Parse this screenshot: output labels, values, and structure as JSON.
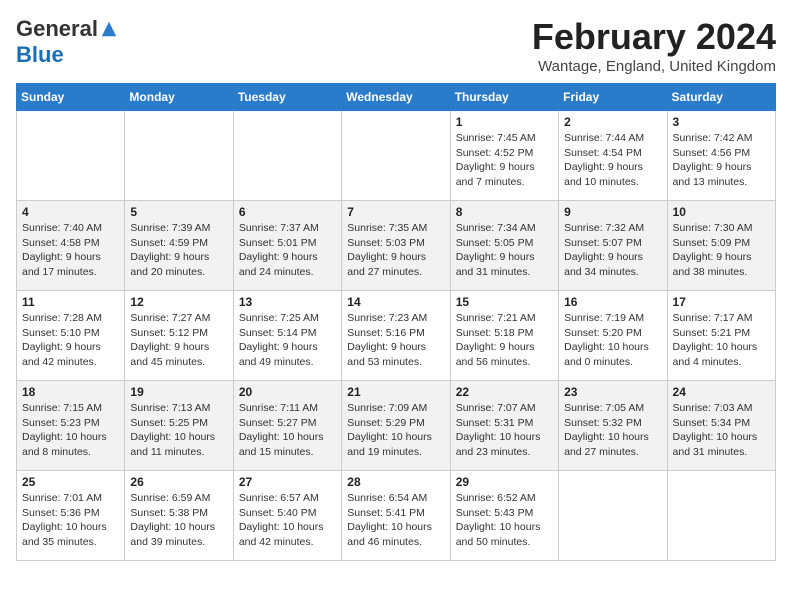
{
  "header": {
    "logo_line1": "General",
    "logo_line2": "Blue",
    "month": "February 2024",
    "location": "Wantage, England, United Kingdom"
  },
  "weekdays": [
    "Sunday",
    "Monday",
    "Tuesday",
    "Wednesday",
    "Thursday",
    "Friday",
    "Saturday"
  ],
  "weeks": [
    [
      {
        "day": "",
        "info": ""
      },
      {
        "day": "",
        "info": ""
      },
      {
        "day": "",
        "info": ""
      },
      {
        "day": "",
        "info": ""
      },
      {
        "day": "1",
        "info": "Sunrise: 7:45 AM\nSunset: 4:52 PM\nDaylight: 9 hours and 7 minutes."
      },
      {
        "day": "2",
        "info": "Sunrise: 7:44 AM\nSunset: 4:54 PM\nDaylight: 9 hours and 10 minutes."
      },
      {
        "day": "3",
        "info": "Sunrise: 7:42 AM\nSunset: 4:56 PM\nDaylight: 9 hours and 13 minutes."
      }
    ],
    [
      {
        "day": "4",
        "info": "Sunrise: 7:40 AM\nSunset: 4:58 PM\nDaylight: 9 hours and 17 minutes."
      },
      {
        "day": "5",
        "info": "Sunrise: 7:39 AM\nSunset: 4:59 PM\nDaylight: 9 hours and 20 minutes."
      },
      {
        "day": "6",
        "info": "Sunrise: 7:37 AM\nSunset: 5:01 PM\nDaylight: 9 hours and 24 minutes."
      },
      {
        "day": "7",
        "info": "Sunrise: 7:35 AM\nSunset: 5:03 PM\nDaylight: 9 hours and 27 minutes."
      },
      {
        "day": "8",
        "info": "Sunrise: 7:34 AM\nSunset: 5:05 PM\nDaylight: 9 hours and 31 minutes."
      },
      {
        "day": "9",
        "info": "Sunrise: 7:32 AM\nSunset: 5:07 PM\nDaylight: 9 hours and 34 minutes."
      },
      {
        "day": "10",
        "info": "Sunrise: 7:30 AM\nSunset: 5:09 PM\nDaylight: 9 hours and 38 minutes."
      }
    ],
    [
      {
        "day": "11",
        "info": "Sunrise: 7:28 AM\nSunset: 5:10 PM\nDaylight: 9 hours and 42 minutes."
      },
      {
        "day": "12",
        "info": "Sunrise: 7:27 AM\nSunset: 5:12 PM\nDaylight: 9 hours and 45 minutes."
      },
      {
        "day": "13",
        "info": "Sunrise: 7:25 AM\nSunset: 5:14 PM\nDaylight: 9 hours and 49 minutes."
      },
      {
        "day": "14",
        "info": "Sunrise: 7:23 AM\nSunset: 5:16 PM\nDaylight: 9 hours and 53 minutes."
      },
      {
        "day": "15",
        "info": "Sunrise: 7:21 AM\nSunset: 5:18 PM\nDaylight: 9 hours and 56 minutes."
      },
      {
        "day": "16",
        "info": "Sunrise: 7:19 AM\nSunset: 5:20 PM\nDaylight: 10 hours and 0 minutes."
      },
      {
        "day": "17",
        "info": "Sunrise: 7:17 AM\nSunset: 5:21 PM\nDaylight: 10 hours and 4 minutes."
      }
    ],
    [
      {
        "day": "18",
        "info": "Sunrise: 7:15 AM\nSunset: 5:23 PM\nDaylight: 10 hours and 8 minutes."
      },
      {
        "day": "19",
        "info": "Sunrise: 7:13 AM\nSunset: 5:25 PM\nDaylight: 10 hours and 11 minutes."
      },
      {
        "day": "20",
        "info": "Sunrise: 7:11 AM\nSunset: 5:27 PM\nDaylight: 10 hours and 15 minutes."
      },
      {
        "day": "21",
        "info": "Sunrise: 7:09 AM\nSunset: 5:29 PM\nDaylight: 10 hours and 19 minutes."
      },
      {
        "day": "22",
        "info": "Sunrise: 7:07 AM\nSunset: 5:31 PM\nDaylight: 10 hours and 23 minutes."
      },
      {
        "day": "23",
        "info": "Sunrise: 7:05 AM\nSunset: 5:32 PM\nDaylight: 10 hours and 27 minutes."
      },
      {
        "day": "24",
        "info": "Sunrise: 7:03 AM\nSunset: 5:34 PM\nDaylight: 10 hours and 31 minutes."
      }
    ],
    [
      {
        "day": "25",
        "info": "Sunrise: 7:01 AM\nSunset: 5:36 PM\nDaylight: 10 hours and 35 minutes."
      },
      {
        "day": "26",
        "info": "Sunrise: 6:59 AM\nSunset: 5:38 PM\nDaylight: 10 hours and 39 minutes."
      },
      {
        "day": "27",
        "info": "Sunrise: 6:57 AM\nSunset: 5:40 PM\nDaylight: 10 hours and 42 minutes."
      },
      {
        "day": "28",
        "info": "Sunrise: 6:54 AM\nSunset: 5:41 PM\nDaylight: 10 hours and 46 minutes."
      },
      {
        "day": "29",
        "info": "Sunrise: 6:52 AM\nSunset: 5:43 PM\nDaylight: 10 hours and 50 minutes."
      },
      {
        "day": "",
        "info": ""
      },
      {
        "day": "",
        "info": ""
      }
    ]
  ]
}
